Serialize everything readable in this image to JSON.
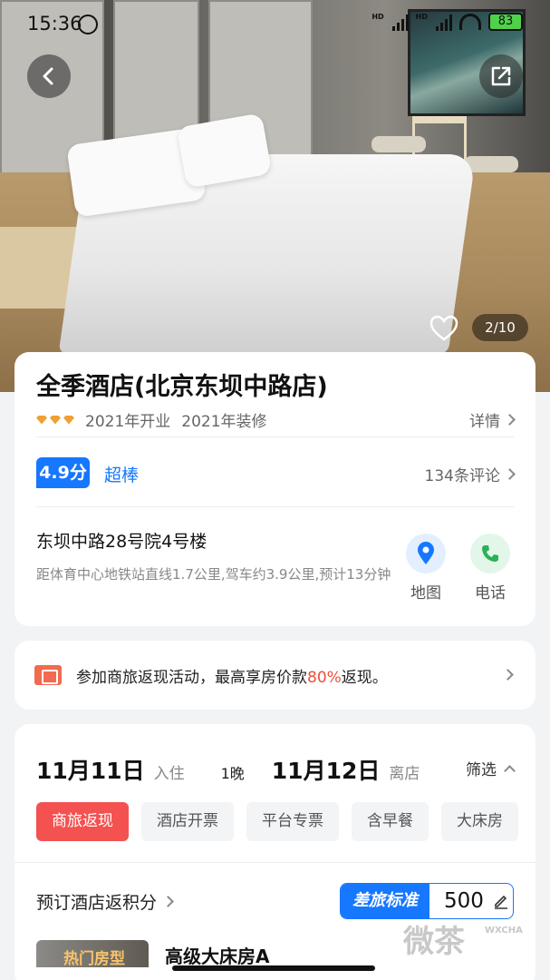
{
  "status": {
    "time": "15:36",
    "battery": "83"
  },
  "gallery": {
    "counter": "2/10"
  },
  "hotel": {
    "name": "全季酒店(北京东坝中路店)",
    "opened": "2021年开业",
    "renovated": "2021年装修",
    "details_label": "详情",
    "score": "4.9分",
    "score_word": "超棒",
    "reviews": "134条评论",
    "address": "东坝中路28号院4号楼",
    "distance": "距体育中心地铁站直线1.7公里,驾车约3.9公里,预计13分钟",
    "map_label": "地图",
    "phone_label": "电话"
  },
  "promo": {
    "text_before": "参加商旅返现活动，最高享房价款",
    "highlight": "80%",
    "text_after": "返现。",
    "colors": {
      "highlight": "#f04d3d"
    }
  },
  "booking": {
    "checkin_date": "11月11日",
    "checkin_label": "入住",
    "nights": "1晚",
    "checkout_date": "11月12日",
    "checkout_label": "离店",
    "filter_label": "筛选",
    "tags": [
      "商旅返现",
      "酒店开票",
      "平台专票",
      "含早餐",
      "大床房"
    ],
    "points_label": "预订酒店返积分",
    "standard_label": "差旅标准",
    "standard_value": "500",
    "room_tag": "热门房型",
    "room_name": "高级大床房A"
  },
  "watermark": {
    "text": "微茶",
    "tag": "WXCHA"
  },
  "colors": {
    "accent": "#1677ff",
    "tag_active": "#f45151"
  }
}
